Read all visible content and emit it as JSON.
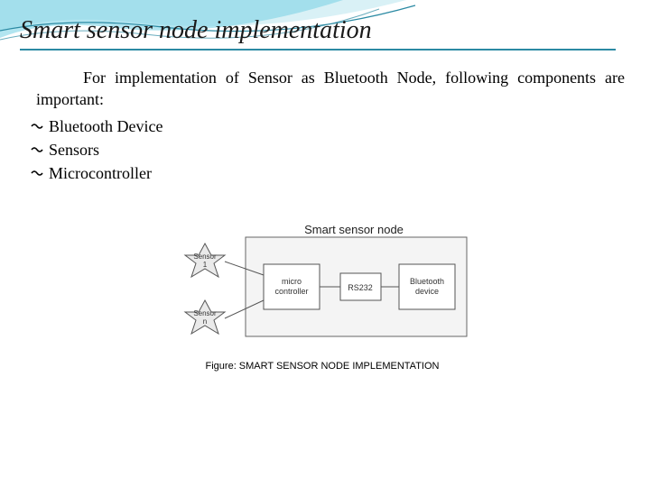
{
  "title": "Smart sensor node implementation",
  "intro": "For implementation of Sensor as Bluetooth Node, following components are important:",
  "bullets": [
    "Bluetooth Device",
    "Sensors",
    "Microcontroller"
  ],
  "diagram": {
    "box_label": "Smart sensor node",
    "sensor1": "Sensor 1",
    "sensorN": "Sensor n",
    "micro": "micro controller",
    "rs232": "RS232",
    "bluetooth": "Bluetooth device"
  },
  "caption": "Figure: SMART SENSOR NODE IMPLEMENTATION",
  "colors": {
    "accent": "#2b8aa3",
    "wave_light": "#bfe6ef",
    "wave_mid": "#5fc6dd",
    "wave_line": "#2b8aa3"
  }
}
